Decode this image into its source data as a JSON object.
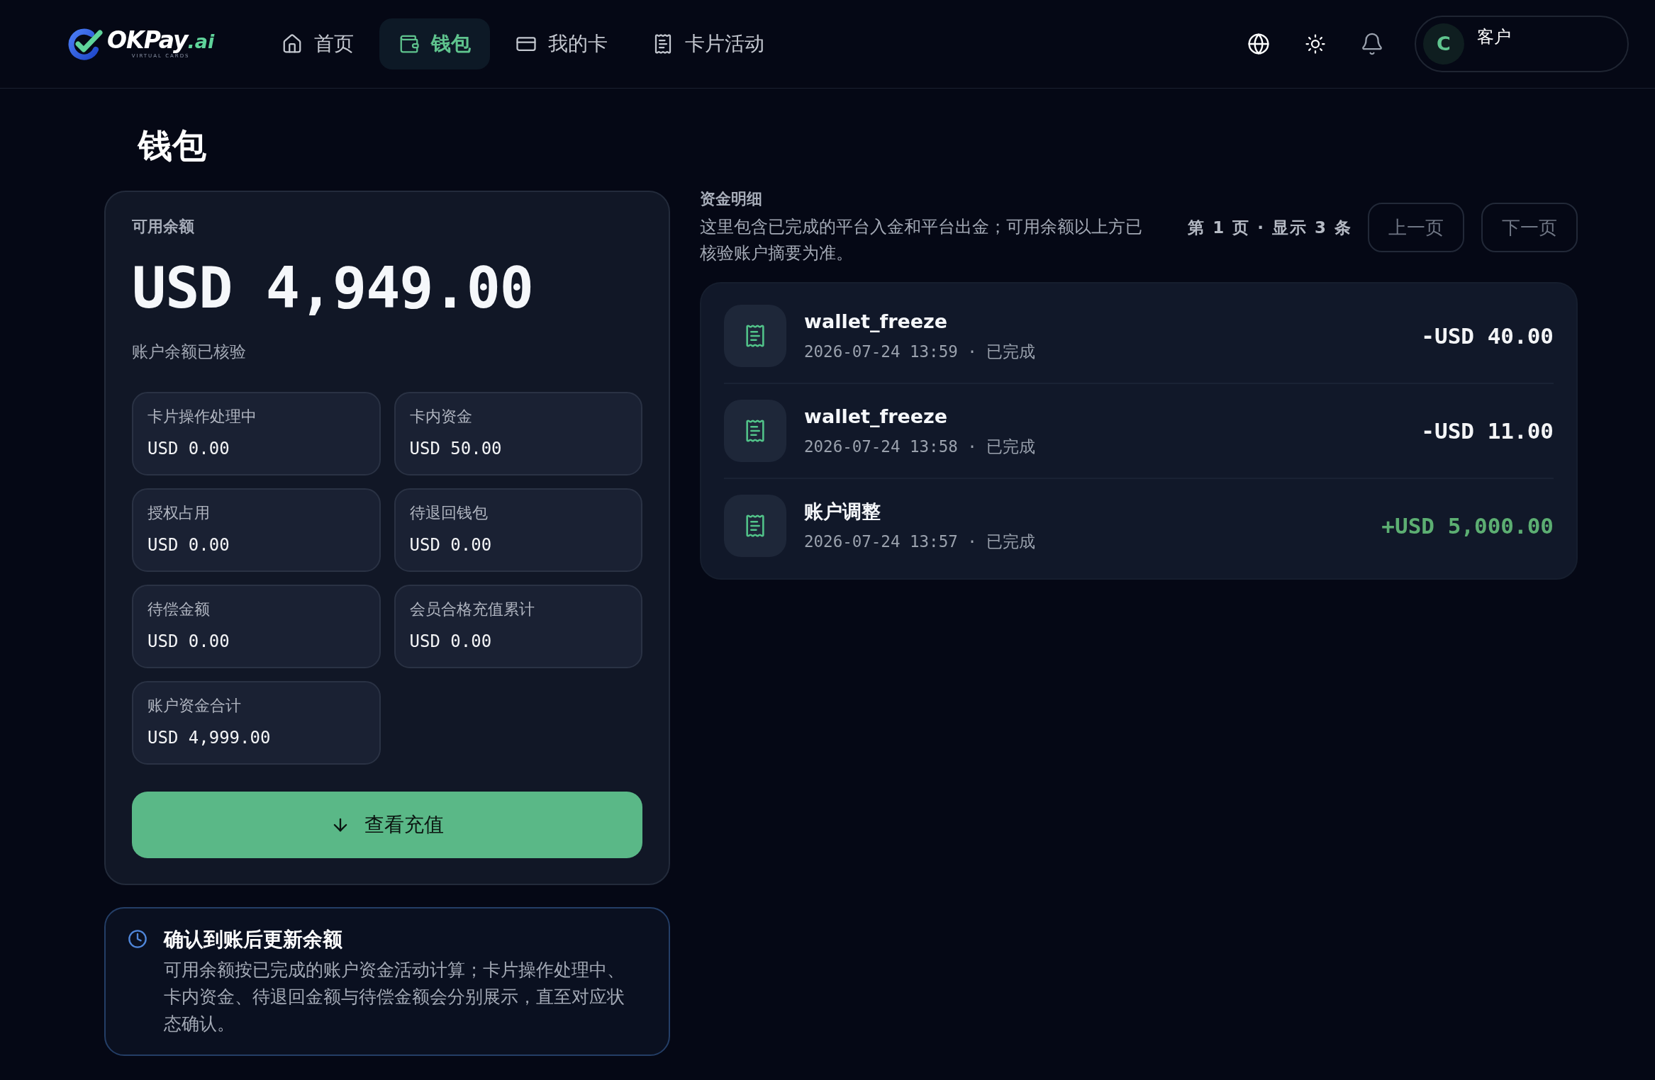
{
  "header": {
    "logo": {
      "name": "OKPay",
      "suffix": ".ai",
      "tagline": "VIRTUAL CARDS"
    },
    "nav": [
      {
        "label": "首页",
        "selected": false
      },
      {
        "label": "钱包",
        "selected": true
      },
      {
        "label": "我的卡",
        "selected": false
      },
      {
        "label": "卡片活动",
        "selected": false
      }
    ],
    "user": {
      "initial": "C",
      "name": "客户"
    }
  },
  "page_title": "钱包",
  "balance_card": {
    "label": "可用余额",
    "amount": "USD 4,949.00",
    "note": "账户余额已核验",
    "items": [
      {
        "label": "卡片操作处理中",
        "value": "USD 0.00"
      },
      {
        "label": "卡内资金",
        "value": "USD 50.00"
      },
      {
        "label": "授权占用",
        "value": "USD 0.00"
      },
      {
        "label": "待退回钱包",
        "value": "USD 0.00"
      },
      {
        "label": "待偿金额",
        "value": "USD 0.00"
      },
      {
        "label": "会员合格充值累计",
        "value": "USD 0.00"
      },
      {
        "label": "账户资金合计",
        "value": "USD 4,999.00"
      }
    ],
    "button": "查看充值"
  },
  "notice": {
    "title": "确认到账后更新余额",
    "body": "可用余额按已完成的账户资金活动计算；卡片操作处理中、卡内资金、待退回金额与待偿金额会分别展示，直至对应状态确认。"
  },
  "ledger": {
    "title": "资金明细",
    "description": "这里包含已完成的平台入金和平台出金；可用余额以上方已核验账户摘要为准。",
    "page_info": "第 1 页 · 显示 3 条",
    "pager": [
      {
        "label": "上一页",
        "disabled": true
      },
      {
        "label": "下一页",
        "disabled": true
      }
    ],
    "entries": [
      {
        "title": "wallet_freeze",
        "meta": "2026-07-24 13:59 · 已完成",
        "amount": "-USD 40.00",
        "kind": "debit"
      },
      {
        "title": "wallet_freeze",
        "meta": "2026-07-24 13:58 · 已完成",
        "amount": "-USD 11.00",
        "kind": "debit"
      },
      {
        "title": "账户调整",
        "meta": "2026-07-24 13:57 · 已完成",
        "amount": "+USD 5,000.00",
        "kind": "credit"
      }
    ]
  }
}
